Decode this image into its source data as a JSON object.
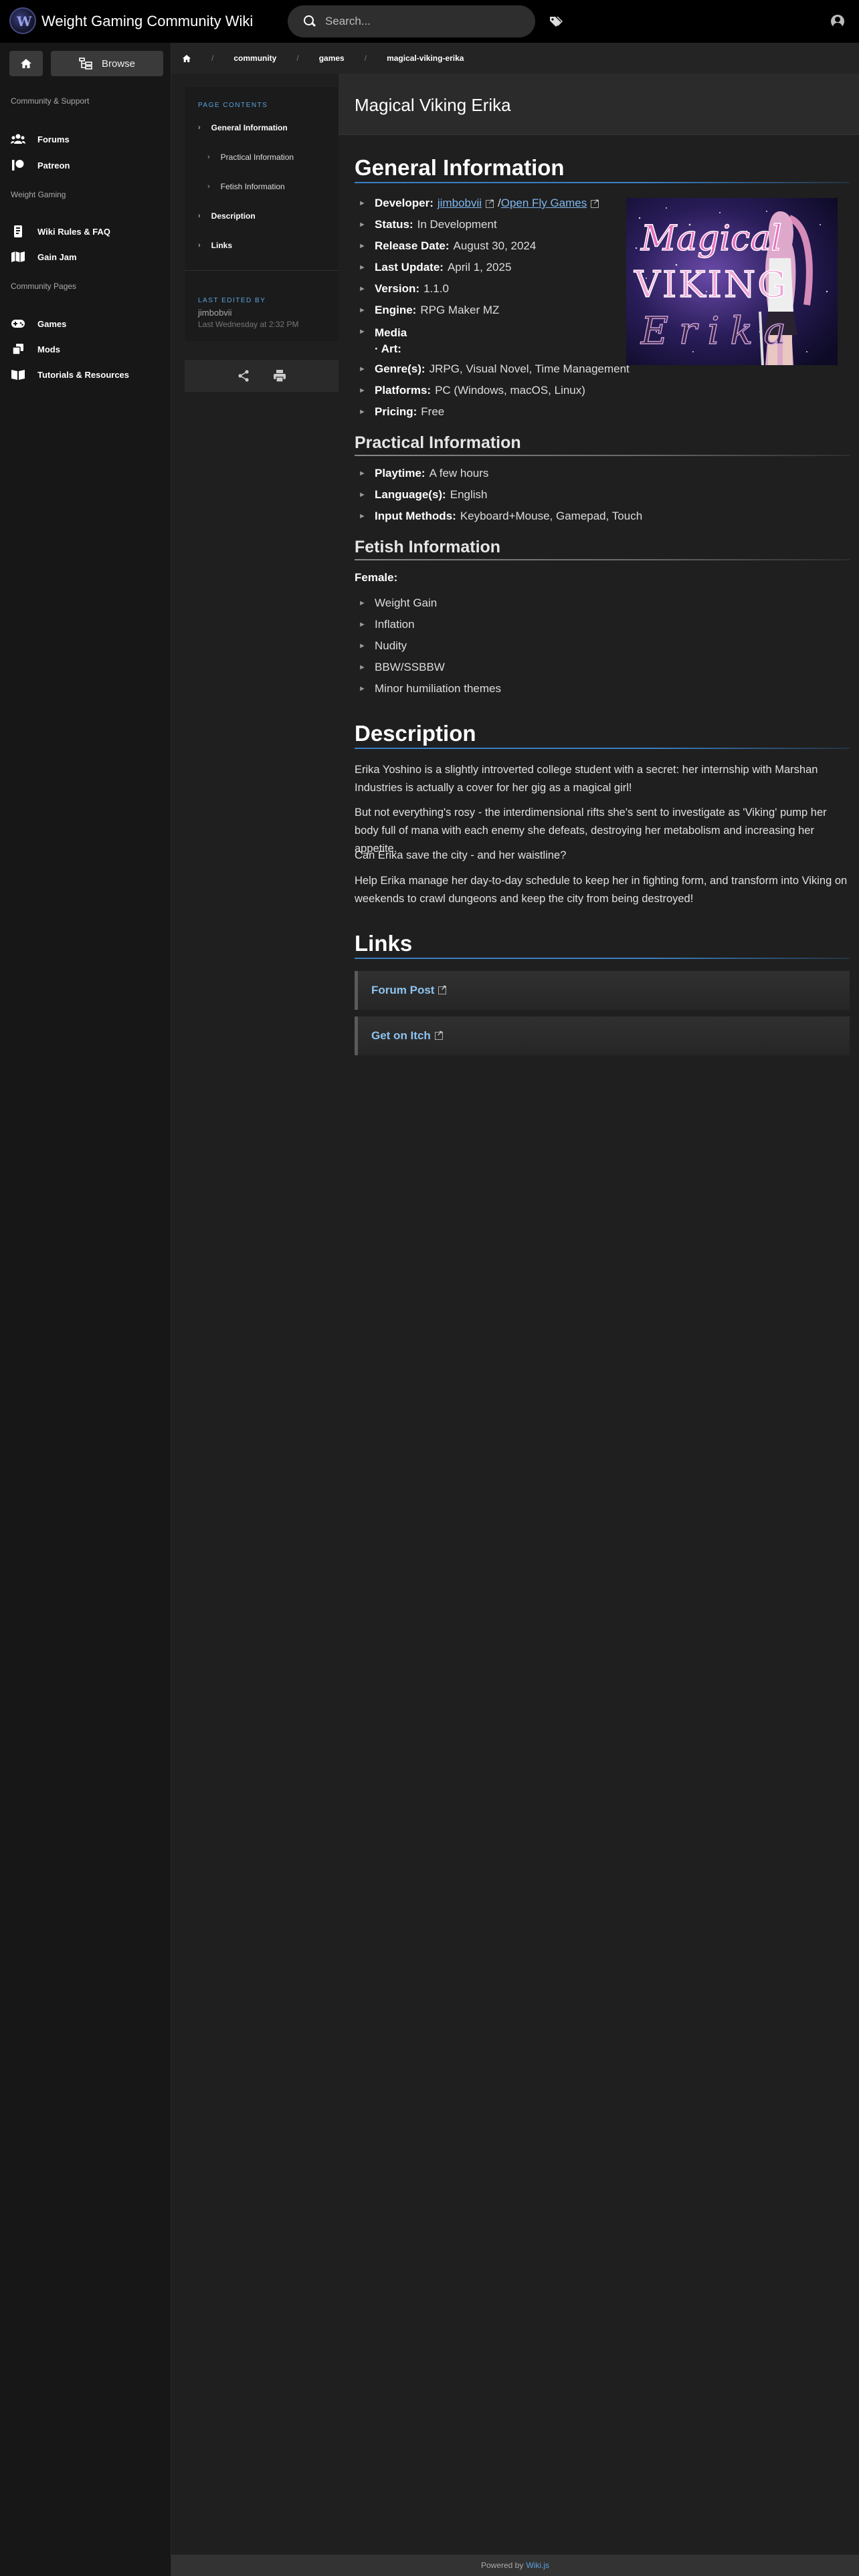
{
  "header": {
    "site_title": "Weight Gaming Community Wiki",
    "search_placeholder": "Search..."
  },
  "sidebar": {
    "browse_label": "Browse",
    "sections": [
      {
        "label": "Community & Support"
      },
      {
        "label": "Weight Gaming"
      },
      {
        "label": "Community Pages"
      }
    ],
    "items": [
      {
        "label": "Forums",
        "icon": "users-icon"
      },
      {
        "label": "Patreon",
        "icon": "patreon-icon"
      },
      {
        "label": "Wiki Rules & FAQ",
        "icon": "rules-icon"
      },
      {
        "label": "Gain Jam",
        "icon": "map-icon"
      },
      {
        "label": "Games",
        "icon": "gamepad-icon"
      },
      {
        "label": "Mods",
        "icon": "layers-icon"
      },
      {
        "label": "Tutorials & Resources",
        "icon": "book-icon"
      }
    ]
  },
  "breadcrumb": {
    "items": [
      "community",
      "games",
      "magical-viking-erika"
    ]
  },
  "toc": {
    "title": "PAGE CONTENTS",
    "items": [
      "General Information",
      "Practical Information",
      "Fetish Information",
      "Description",
      "Links"
    ],
    "last_edited_label": "LAST EDITED BY",
    "last_edited_user": "jimbobvii",
    "last_edited_time": "Last Wednesday at 2:32 PM"
  },
  "page": {
    "title": "Magical Viking Erika"
  },
  "general": {
    "heading": "General Information",
    "developer_label": "Developer:",
    "developer_link1": "jimbobvii",
    "developer_sep": "/",
    "developer_link2": "Open Fly Games",
    "status_label": "Status:",
    "status": "In Development",
    "release_label": "Release Date:",
    "release": "August 30, 2024",
    "update_label": "Last Update:",
    "update": "April 1, 2025",
    "version_label": "Version:",
    "version": "1.1.0",
    "engine_label": "Engine:",
    "engine": "RPG Maker MZ",
    "media_label": "Media",
    "art_label": "· Art:",
    "genre_label": "Genre(s):",
    "genre": "JRPG, Visual Novel, Time Management",
    "platforms_label": "Platforms:",
    "platforms": "PC (Windows, macOS, Linux)",
    "pricing_label": "Pricing:",
    "pricing": "Free",
    "image_text_line1": "Magical",
    "image_text_line2": "VIKING",
    "image_text_line3": "Erika"
  },
  "practical": {
    "heading": "Practical Information",
    "playtime_label": "Playtime:",
    "playtime": "A few hours",
    "language_label": "Language(s):",
    "language": "English",
    "input_label": "Input Methods:",
    "input": "Keyboard+Mouse, Gamepad, Touch"
  },
  "fetish": {
    "heading": "Fetish Information",
    "female_label": "Female:",
    "items": [
      "Weight Gain",
      "Inflation",
      "Nudity",
      "BBW/SSBBW",
      "Minor humiliation themes"
    ]
  },
  "description": {
    "heading": "Description",
    "paragraphs": [
      "Erika Yoshino is a slightly introverted college student with a secret: her internship with Marshan Industries is actually a cover for her gig as a magical girl!",
      "But not everything's rosy - the interdimensional rifts she's sent to investigate as 'Viking' pump her body full of mana with each enemy she defeats, destroying her metabolism and increasing her appetite.",
      "Can Erika save the city - and her waistline?",
      "Help Erika manage her day-to-day schedule to keep her in fighting form, and transform into Viking on weekends to crawl dungeons and keep the city from being destroyed!"
    ]
  },
  "links": {
    "heading": "Links",
    "items": [
      "Forum Post",
      "Get on Itch"
    ]
  },
  "footer": {
    "text": "Powered by",
    "product": "Wiki.js"
  }
}
